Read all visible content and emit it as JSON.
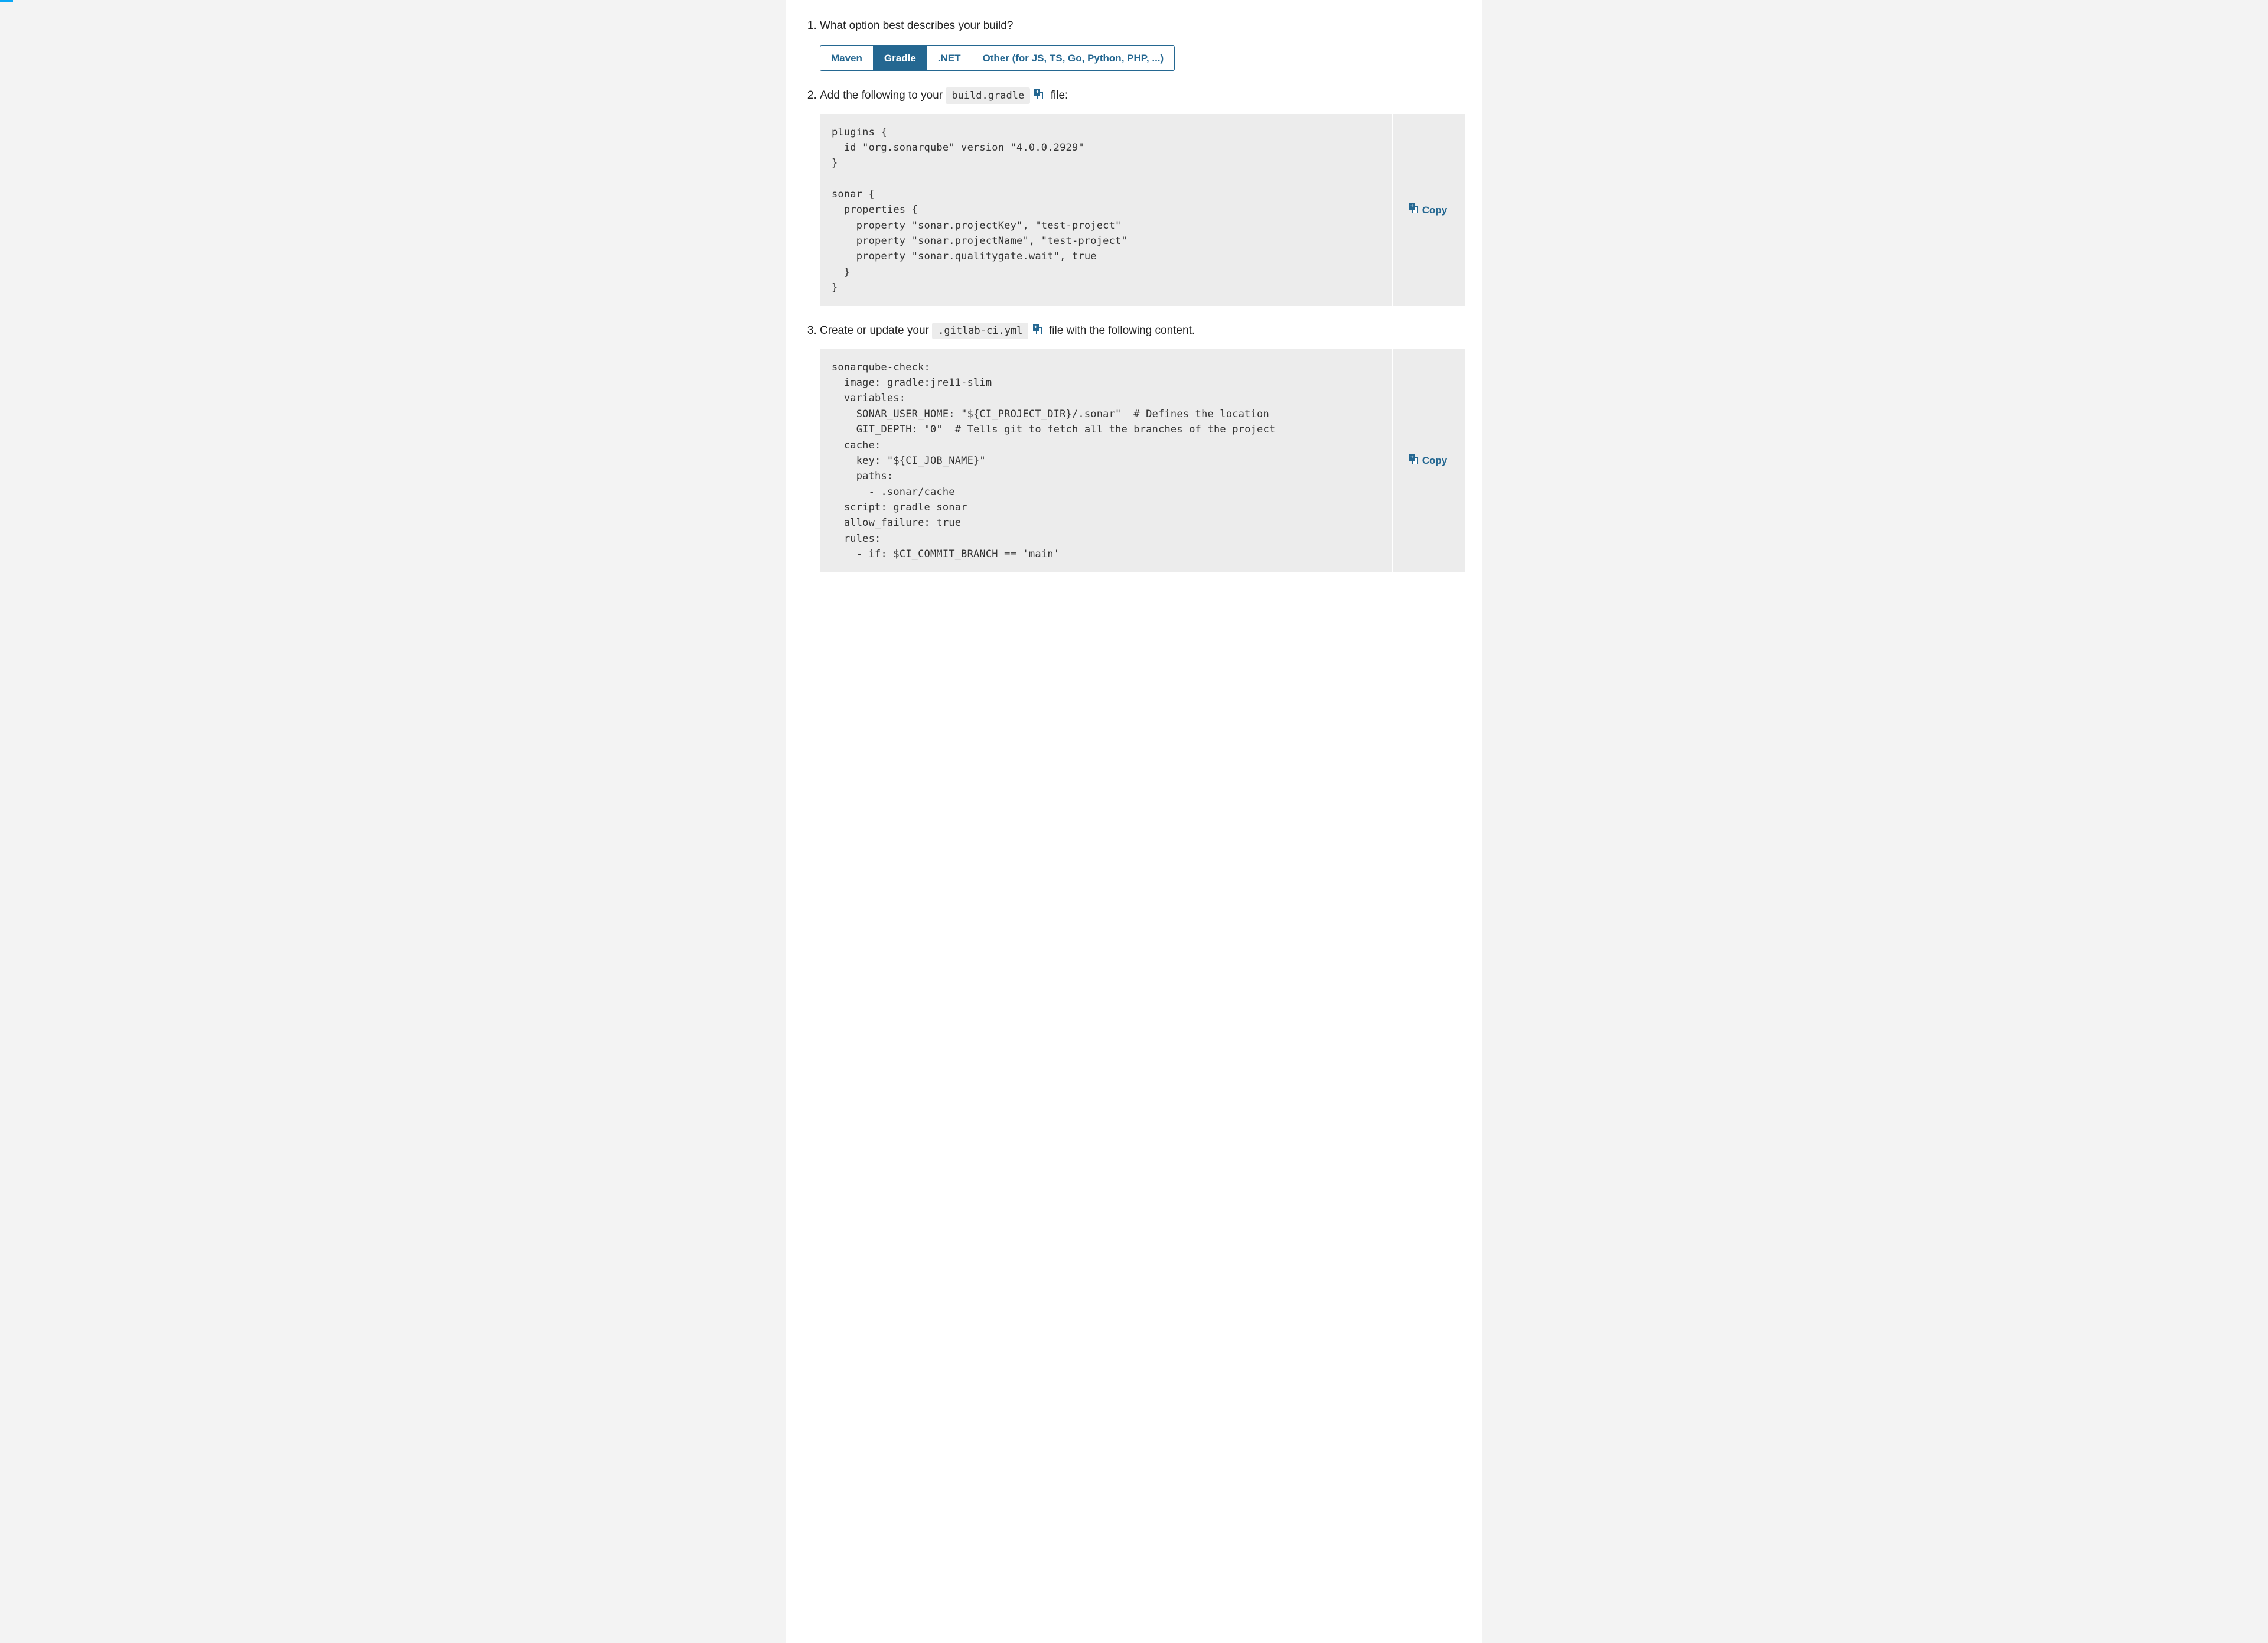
{
  "steps": {
    "one": {
      "title": "What option best describes your build?",
      "options": [
        "Maven",
        "Gradle",
        ".NET",
        "Other (for JS, TS, Go, Python, PHP, ...)"
      ],
      "active_index": 1
    },
    "two": {
      "prefix": "Add the following to your ",
      "file": "build.gradle",
      "suffix": " file:",
      "copy_label": "Copy",
      "code": "plugins {\n  id \"org.sonarqube\" version \"4.0.0.2929\"\n}\n\nsonar {\n  properties {\n    property \"sonar.projectKey\", \"test-project\"\n    property \"sonar.projectName\", \"test-project\"\n    property \"sonar.qualitygate.wait\", true\n  }\n}"
    },
    "three": {
      "prefix": "Create or update your ",
      "file": ".gitlab-ci.yml",
      "suffix": " file with the following content.",
      "copy_label": "Copy",
      "code": "sonarqube-check:\n  image: gradle:jre11-slim\n  variables:\n    SONAR_USER_HOME: \"${CI_PROJECT_DIR}/.sonar\"  # Defines the location\n    GIT_DEPTH: \"0\"  # Tells git to fetch all the branches of the project\n  cache:\n    key: \"${CI_JOB_NAME}\"\n    paths:\n      - .sonar/cache\n  script: gradle sonar\n  allow_failure: true\n  rules:\n    - if: $CI_COMMIT_BRANCH == 'main'"
    }
  }
}
